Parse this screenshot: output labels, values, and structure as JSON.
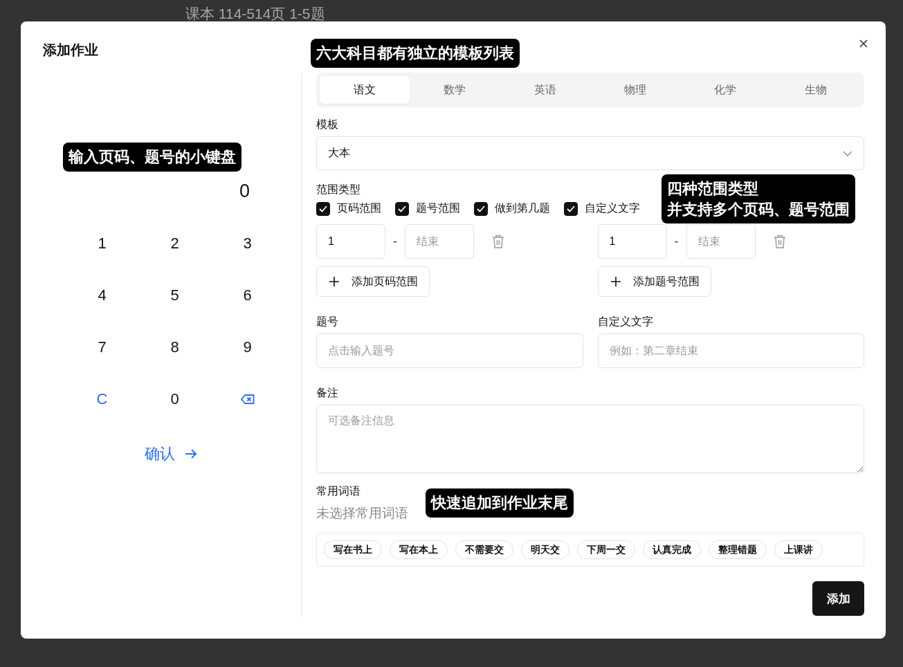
{
  "background": {
    "text": "课本 114-514页 1-5题"
  },
  "dialog": {
    "title": "添加作业"
  },
  "keypad": {
    "display": "0",
    "keys": [
      {
        "kind": "digit",
        "label": "1"
      },
      {
        "kind": "digit",
        "label": "2"
      },
      {
        "kind": "digit",
        "label": "3"
      },
      {
        "kind": "digit",
        "label": "4"
      },
      {
        "kind": "digit",
        "label": "5"
      },
      {
        "kind": "digit",
        "label": "6"
      },
      {
        "kind": "digit",
        "label": "7"
      },
      {
        "kind": "digit",
        "label": "8"
      },
      {
        "kind": "digit",
        "label": "9"
      },
      {
        "kind": "clear",
        "label": "C"
      },
      {
        "kind": "digit",
        "label": "0"
      },
      {
        "kind": "backspace"
      }
    ],
    "confirm": "确认"
  },
  "subject_tabs": [
    {
      "label": "语文",
      "selected": true
    },
    {
      "label": "数学",
      "selected": false
    },
    {
      "label": "英语",
      "selected": false
    },
    {
      "label": "物理",
      "selected": false
    },
    {
      "label": "化学",
      "selected": false
    },
    {
      "label": "生物",
      "selected": false
    }
  ],
  "template": {
    "label": "模板",
    "value": "大本"
  },
  "range_types": {
    "label": "范围类型",
    "options": [
      {
        "label": "页码范围",
        "checked": true
      },
      {
        "label": "题号范围",
        "checked": true
      },
      {
        "label": "做到第几题",
        "checked": true
      },
      {
        "label": "自定义文字",
        "checked": true
      }
    ]
  },
  "page_ranges": {
    "rows": [
      {
        "start": "1",
        "separator": "-",
        "end_placeholder": "结束"
      }
    ],
    "add_button": "添加页码范围"
  },
  "question_ranges": {
    "rows": [
      {
        "start": "1",
        "separator": "-",
        "end_placeholder": "结束"
      }
    ],
    "add_button": "添加题号范围"
  },
  "question_number": {
    "label": "题号",
    "placeholder": "点击输入题号"
  },
  "custom_text": {
    "label": "自定义文字",
    "placeholder": "例如：第二章结束"
  },
  "note": {
    "label": "备注",
    "placeholder": "可选备注信息"
  },
  "phrases": {
    "label": "常用词语",
    "status": "未选择常用词语",
    "chips": [
      "写在书上",
      "写在本上",
      "不需要交",
      "明天交",
      "下周一交",
      "认真完成",
      "整理错题",
      "上课讲"
    ]
  },
  "submit": "添加",
  "annotations": [
    {
      "lines": [
        "六大科目都有独立的模板列表"
      ]
    },
    {
      "lines": [
        "输入页码、题号的小键盘"
      ]
    },
    {
      "lines": [
        "四种范围类型",
        "并支持多个页码、题号范围"
      ]
    },
    {
      "lines": [
        "快速追加到作业末尾"
      ]
    }
  ]
}
